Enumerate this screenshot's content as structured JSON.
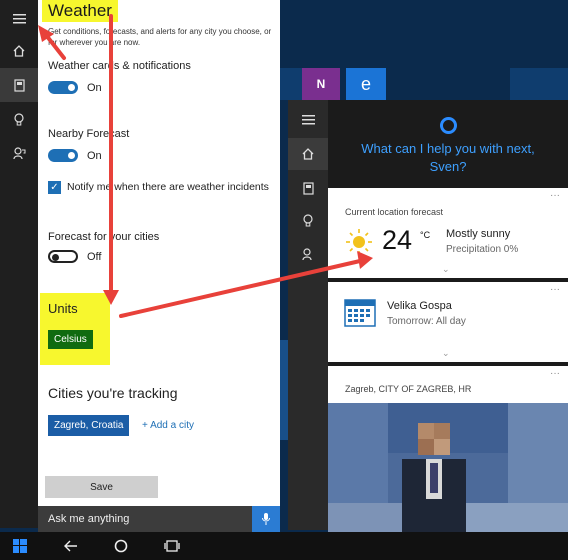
{
  "colors": {
    "accent": "#1e6fb5",
    "highlight": "#f7f72e",
    "arrow": "#e8413a",
    "units_button": "#106b10",
    "cortana_blue": "#3ea0ff"
  },
  "rail": {
    "items": [
      "hamburger-icon",
      "home-icon",
      "notebook-icon",
      "lightbulb-icon",
      "feedback-icon"
    ]
  },
  "notebook": {
    "title": "Weather",
    "description": "Get conditions, forecasts, and alerts for any city you choose, or for wherever you are now.",
    "cards_label": "Weather cards & notifications",
    "cards_state": "On",
    "nearby_label": "Nearby Forecast",
    "nearby_state": "On",
    "notify_label": "Notify me when there are weather incidents",
    "cities_forecast_label": "Forecast for your cities",
    "cities_forecast_state": "Off",
    "units_heading": "Units",
    "units_value": "Celsius",
    "cities_heading": "Cities you're tracking",
    "city": "Zagreb, Croatia",
    "add_city": "+ Add a city",
    "save": "Save"
  },
  "askbar": {
    "placeholder": "Ask me anything"
  },
  "cortana": {
    "prompt_line1": "What can I help you with next,",
    "prompt_line2": "Sven?",
    "weather_card": {
      "header": "Current location forecast",
      "temperature": "24",
      "unit": "°C",
      "condition": "Mostly sunny",
      "precipitation": "Precipitation 0%"
    },
    "calendar_card": {
      "title": "Velika Gospa",
      "subtitle": "Tomorrow: All day"
    },
    "news_card": {
      "header": "Zagreb, CITY OF ZAGREB, HR"
    },
    "more": "···",
    "chevron": "⌄"
  },
  "taskbar": {
    "items": [
      "windows-icon",
      "back-icon",
      "home-icon",
      "task-view-icon"
    ]
  }
}
